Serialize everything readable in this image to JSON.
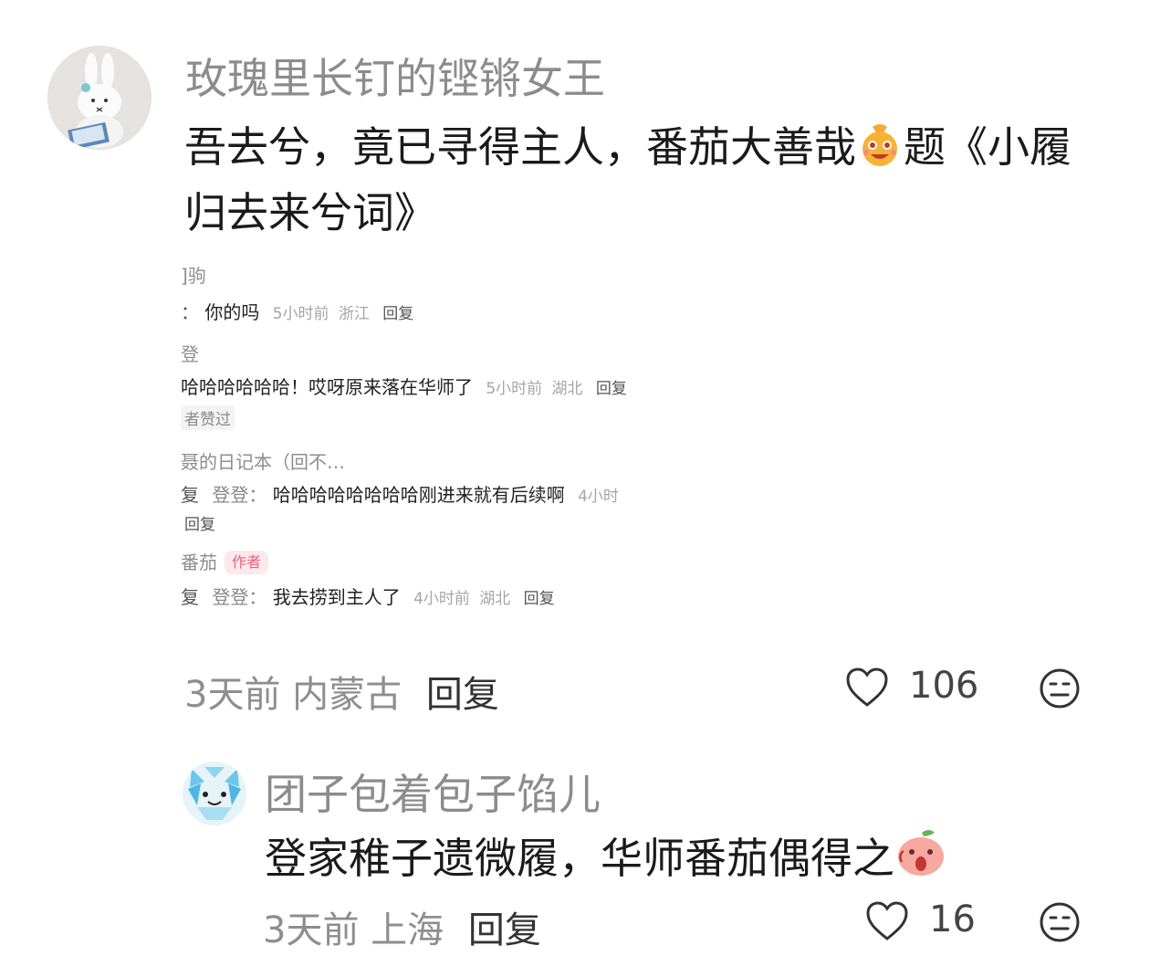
{
  "comments": [
    {
      "username": "玫瑰里长钉的铿锵女王",
      "text": "吾去兮，竟已寻得主人，番茄大善哉",
      "text_after_emoji": "题《小履归去来兮词》",
      "emoji": "smiling-bag-emoji",
      "time": "3天前",
      "location": "内蒙古",
      "reply_label": "回复",
      "like_count": "106",
      "embedded_screenshot": {
        "items": [
          {
            "name": "]驹"
          },
          {
            "prefix": "：",
            "text": "你的吗",
            "time": "5小时前",
            "location": "浙江",
            "reply_label": "回复"
          },
          {
            "name": "登"
          },
          {
            "text": "哈哈哈哈哈哈！哎呀原来落在华师了",
            "time": "5小时前",
            "location": "湖北",
            "reply_label": "回复"
          },
          {
            "chip": "者赞过"
          },
          {
            "name": "聂的日记本（回不…"
          },
          {
            "prefix": "复",
            "reply_to": "登登：",
            "text": "哈哈哈哈哈哈哈哈刚进来就有后续啊",
            "time": "4小时"
          },
          {
            "reply_label": "回复"
          },
          {
            "name": "番茄",
            "badge": "作者"
          },
          {
            "prefix": "复",
            "reply_to": "登登：",
            "text": "我去捞到主人了",
            "time": "4小时前",
            "location": "湖北",
            "reply_label": "回复"
          }
        ]
      }
    },
    {
      "username": "团子包着包子馅儿",
      "text": "登家稚子遗微履，华师番茄偶得之",
      "emoji": "surprised-peach-emoji",
      "time": "3天前",
      "location": "上海",
      "reply_label": "回复",
      "like_count": "16"
    }
  ],
  "icons": {
    "like": "heart-outline-icon",
    "dislike": "neutral-face-icon"
  },
  "colors": {
    "username": "#8c8c8c",
    "text": "#1a1a1a",
    "meta": "#8e8e8e",
    "author_badge_bg": "#fde8ec",
    "author_badge_fg": "#e8637d"
  }
}
